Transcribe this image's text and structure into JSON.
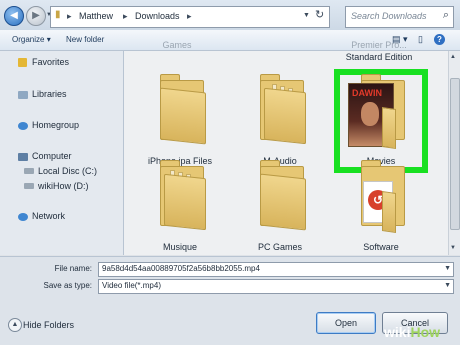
{
  "address": {
    "path": [
      "Matthew",
      "Downloads"
    ],
    "search_placeholder": "Search Downloads"
  },
  "toolbar": {
    "organize_label": "Organize",
    "new_folder_label": "New folder",
    "help_label": "?"
  },
  "nav": {
    "items": [
      {
        "label": "Favorites"
      },
      {
        "label": "Libraries"
      },
      {
        "label": "Homegroup"
      },
      {
        "label": "Computer"
      },
      {
        "label": "Local Disc (C:)"
      },
      {
        "label": "wikiHow (D:)"
      },
      {
        "label": "Network"
      }
    ]
  },
  "content": {
    "top_cut": {
      "games_partial": "Games",
      "premier_partial": "Premier Pro...",
      "standard_edition": "Standard Edition"
    },
    "folders": [
      {
        "label": "iPhone ipa Files"
      },
      {
        "label": "M-Audio"
      },
      {
        "label": "Movies"
      },
      {
        "label": "Musique"
      },
      {
        "label": "PC Games"
      },
      {
        "label": "Software"
      }
    ],
    "poster_text": "DAWIN",
    "selected_folder": "Movies",
    "highlight_color": "#18e021"
  },
  "bottom": {
    "file_name_label": "File name:",
    "file_name_value": "9a58d4d54aa00889705f2a56b8bb2055.mp4",
    "save_type_label": "Save as type:",
    "save_type_value": "Video file(*.mp4)",
    "hide_folders_label": "Hide Folders",
    "open_label": "Open",
    "cancel_label": "Cancel"
  },
  "watermark": {
    "wiki": "wiki",
    "how": "How"
  }
}
